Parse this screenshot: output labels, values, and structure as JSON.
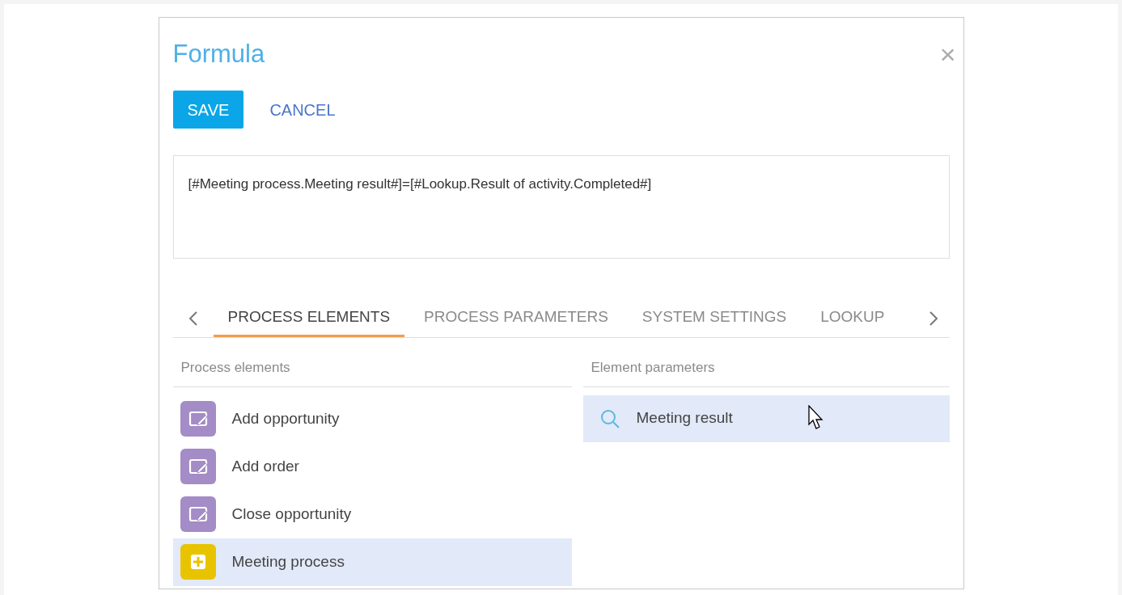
{
  "dialog": {
    "title": "Formula",
    "close": "×"
  },
  "buttons": [
    {
      "label": "SAVE",
      "kind": "primary"
    },
    {
      "label": "CANCEL",
      "kind": "link"
    }
  ],
  "formula": {
    "value": "[#Meeting process.Meeting result#]=[#Lookup.Result of activity.Completed#]"
  },
  "tabs": [
    {
      "label": "PROCESS ELEMENTS",
      "selected": true
    },
    {
      "label": "PROCESS PARAMETERS",
      "selected": false
    },
    {
      "label": "SYSTEM SETTINGS",
      "selected": false
    },
    {
      "label": "LOOKUP",
      "selected": false
    }
  ],
  "process_elements": {
    "header": "Process elements",
    "items": [
      {
        "label": "Add opportunity",
        "kind": "edit",
        "selected": false
      },
      {
        "label": "Add order",
        "kind": "edit",
        "selected": false
      },
      {
        "label": "Close opportunity",
        "kind": "edit",
        "selected": false
      },
      {
        "label": "Meeting process",
        "kind": "subprocess",
        "selected": true
      }
    ]
  },
  "element_parameters": {
    "header": "Element parameters",
    "items": [
      {
        "label": "Meeting result",
        "selected": true
      }
    ]
  }
}
